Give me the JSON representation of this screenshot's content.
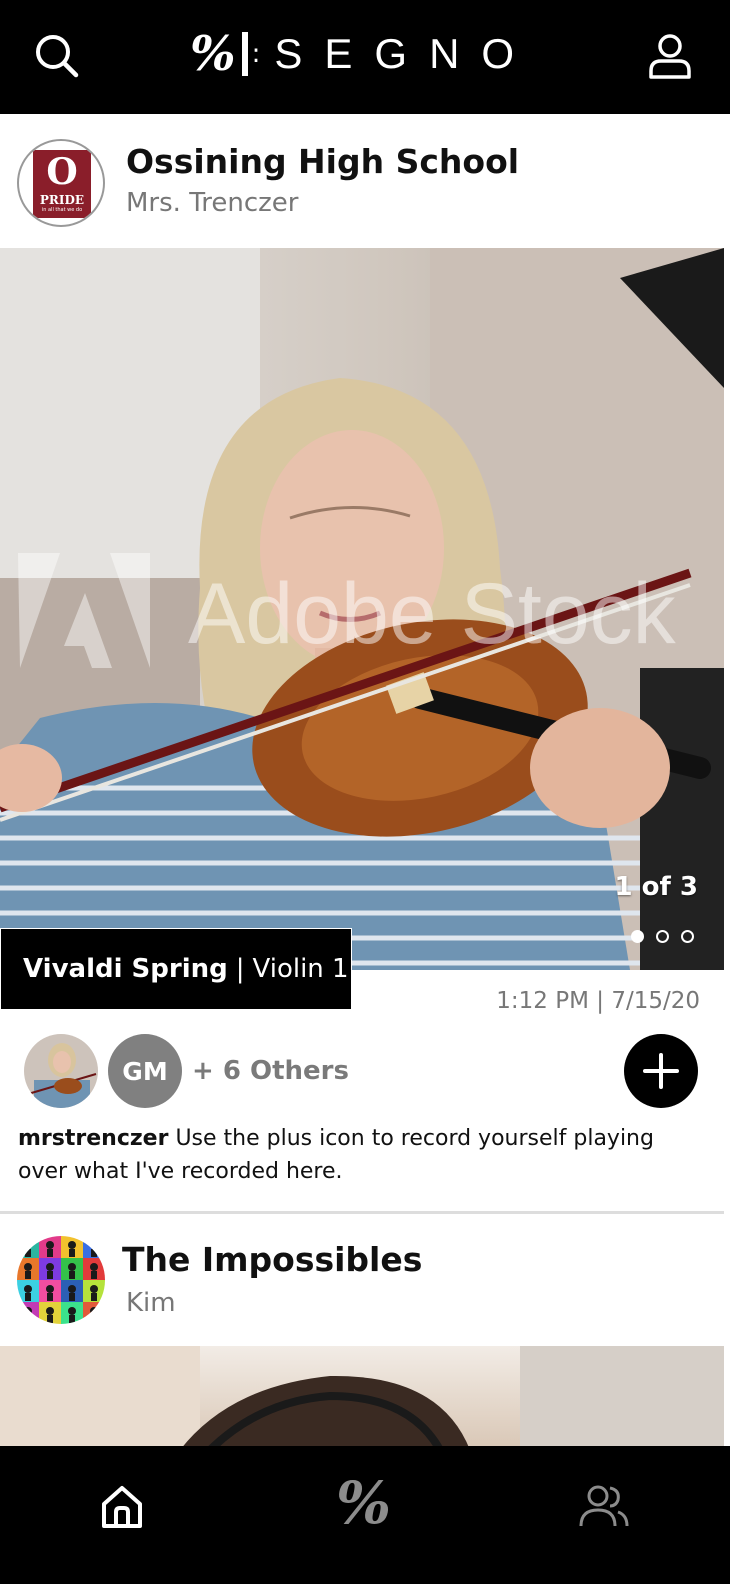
{
  "header": {
    "brand_mark": "𝄋",
    "brand_text": "SEGNO",
    "search_icon": "search-icon",
    "profile_icon": "user-icon"
  },
  "posts": [
    {
      "title": "Ossining High School",
      "subtitle": "Mrs. Trenczer",
      "logo": {
        "letter": "O",
        "word": "PRIDE",
        "motto": "in all that we do"
      },
      "counter": "1 of 3",
      "slides": 3,
      "active_slide": 1,
      "piece": "Vivaldi Spring",
      "separator": "|",
      "part": "Violin 1",
      "timestamp": "1:12 PM | 7/15/20",
      "participant_initials": "GM",
      "others": "+ 6 Others",
      "comment_user": "mrstrenczer",
      "comment_text": "Use the plus icon to record yourself playing over what I've recorded here."
    },
    {
      "title": "The Impossibles",
      "subtitle": "Kim"
    }
  ],
  "watermark": "Adobe Stock",
  "colors": {
    "bar": "#000000",
    "accent": "#8a1e2a",
    "muted": "#777777"
  },
  "nav": [
    "home-icon",
    "segno-icon",
    "people-icon"
  ]
}
